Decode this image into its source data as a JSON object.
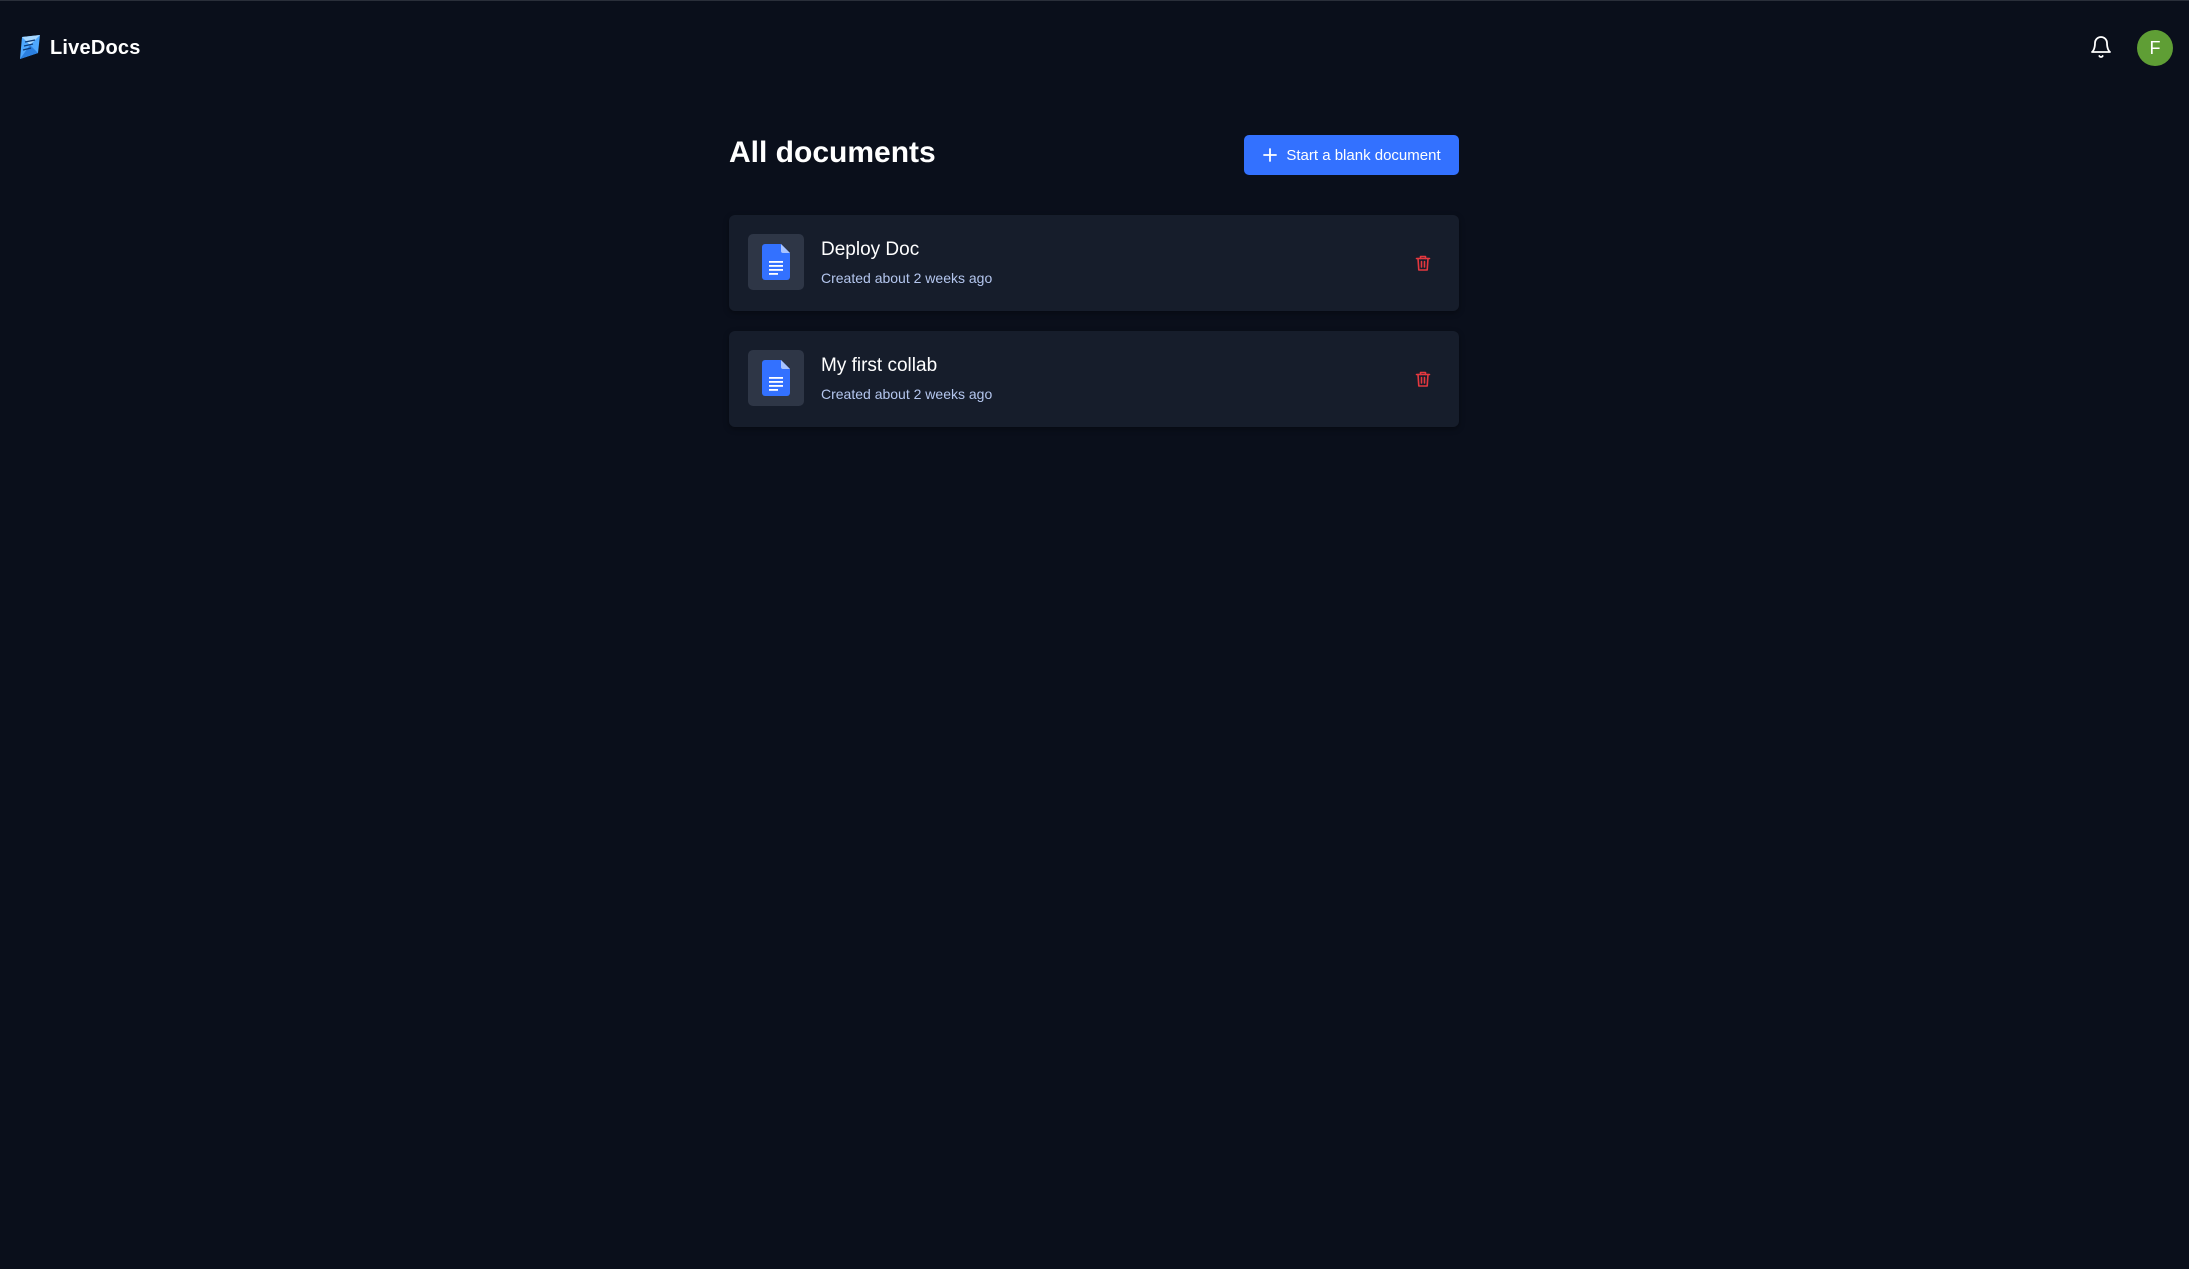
{
  "header": {
    "brand_name": "LiveDocs",
    "logo_icon": "livedocs-logo",
    "notification_icon": "bell-icon",
    "avatar_initial": "F"
  },
  "main": {
    "page_title": "All documents",
    "new_document_button": {
      "label": "Start a blank document",
      "icon": "plus-icon"
    },
    "documents": [
      {
        "title": "Deploy Doc",
        "created": "Created about 2 weeks ago",
        "icon": "document-icon",
        "action_icon": "trash-icon"
      },
      {
        "title": "My first collab",
        "created": "Created about 2 weeks ago",
        "icon": "document-icon",
        "action_icon": "trash-icon"
      }
    ]
  },
  "colors": {
    "background": "#0a0f1b",
    "card": "#161d2b",
    "accent_blue": "#3371ff",
    "avatar_green": "#5f9e35",
    "delete_red": "#e4383f",
    "meta_text": "#b4c6ee"
  }
}
